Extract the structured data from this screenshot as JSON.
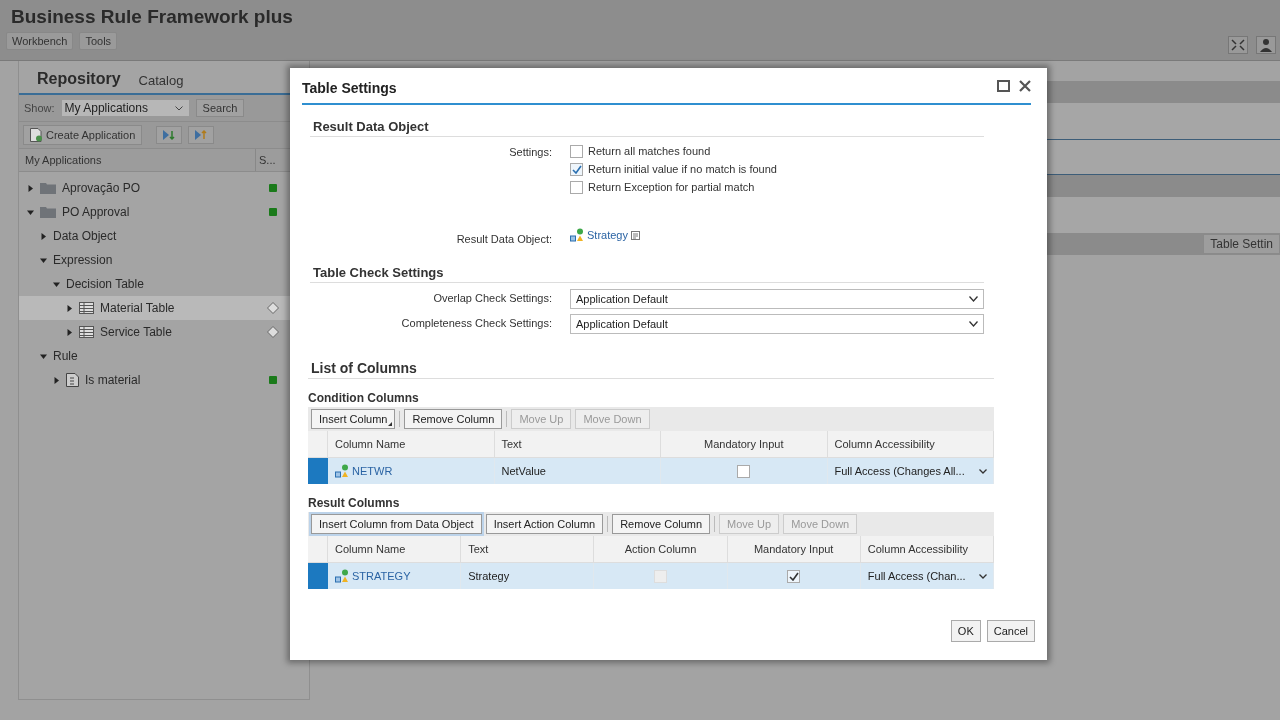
{
  "app": {
    "title": "Business Rule Framework plus",
    "menus": [
      {
        "label": "Workbench"
      },
      {
        "label": "Tools"
      }
    ],
    "tabs": [
      {
        "label": "Repository",
        "selected": true
      },
      {
        "label": "Catalog",
        "selected": false
      }
    ],
    "show": {
      "label": "Show:",
      "value": "My Applications"
    },
    "search_button": "Search",
    "create_button": "Create Application",
    "tree_columns": [
      "My Applications",
      "S..."
    ],
    "tree": [
      {
        "label": "Aprovação PO",
        "kind": "folder",
        "expanded": false,
        "selected": false,
        "active": true
      },
      {
        "label": "PO Approval",
        "kind": "folder",
        "expanded": true,
        "selected": false,
        "active": true,
        "children": [
          {
            "label": "Data Object",
            "expanded": false,
            "selected": false
          },
          {
            "label": "Expression",
            "expanded": true,
            "selected": false,
            "children": [
              {
                "label": "Decision Table",
                "expanded": true,
                "selected": false,
                "children": [
                  {
                    "label": "Material Table",
                    "kind": "table",
                    "expanded": false,
                    "selected": true,
                    "active": false
                  },
                  {
                    "label": "Service Table",
                    "kind": "table",
                    "expanded": false,
                    "selected": false,
                    "active": false
                  }
                ]
              }
            ]
          },
          {
            "label": "Rule",
            "expanded": true,
            "selected": false,
            "children": [
              {
                "label": "Is material",
                "kind": "rule",
                "expanded": false,
                "selected": false,
                "active": true
              }
            ]
          }
        ]
      }
    ],
    "right_button": "Table Settin"
  },
  "dialog": {
    "title": "Table Settings",
    "result_section": {
      "title": "Result Data Object",
      "settings_label": "Settings:",
      "options": [
        {
          "label": "Return all matches found",
          "checked": false
        },
        {
          "label": "Return initial value if no match is found",
          "checked": true
        },
        {
          "label": "Return Exception for partial match",
          "checked": false
        }
      ],
      "object_label": "Result Data Object:",
      "object_value": "Strategy"
    },
    "check_section": {
      "title": "Table Check Settings",
      "fields": [
        {
          "label": "Overlap Check Settings:",
          "value": "Application Default"
        },
        {
          "label": "Completeness Check Settings:",
          "value": "Application Default"
        }
      ]
    },
    "columns_section": {
      "title": "List of Columns",
      "tables": [
        {
          "title": "Condition Columns",
          "toolbar": [
            {
              "label": "Insert Column",
              "disabled": false,
              "menu": true,
              "focused": false
            },
            {
              "label": "Remove Column",
              "disabled": false,
              "menu": false,
              "focused": false
            },
            {
              "label": "Move Up",
              "disabled": true,
              "menu": false,
              "focused": false
            },
            {
              "label": "Move Down",
              "disabled": true,
              "menu": false,
              "focused": false
            }
          ],
          "columns": [
            {
              "label": "Column Name",
              "centered": false
            },
            {
              "label": "Text",
              "centered": false
            },
            {
              "label": "Mandatory Input",
              "centered": true
            },
            {
              "label": "Column Accessibility",
              "centered": false
            }
          ],
          "rows": [
            {
              "selected": true,
              "cells": [
                {
                  "kind": "object",
                  "text": "NETWR"
                },
                {
                  "kind": "text",
                  "text": "NetValue"
                },
                {
                  "kind": "check",
                  "checked": false,
                  "disabled": false
                },
                {
                  "kind": "select",
                  "text": "Full Access (Changes All..."
                }
              ]
            }
          ]
        },
        {
          "title": "Result Columns",
          "toolbar": [
            {
              "label": "Insert Column from Data Object",
              "disabled": false,
              "menu": false,
              "focused": true
            },
            {
              "label": "Insert Action Column",
              "disabled": false,
              "menu": false,
              "focused": false
            },
            {
              "label": "Remove Column",
              "disabled": false,
              "menu": false,
              "focused": false
            },
            {
              "label": "Move Up",
              "disabled": true,
              "menu": false,
              "focused": false
            },
            {
              "label": "Move Down",
              "disabled": true,
              "menu": false,
              "focused": false
            }
          ],
          "columns": [
            {
              "label": "Column Name",
              "centered": false
            },
            {
              "label": "Text",
              "centered": false
            },
            {
              "label": "Action Column",
              "centered": true
            },
            {
              "label": "Mandatory Input",
              "centered": true
            },
            {
              "label": "Column Accessibility",
              "centered": false
            }
          ],
          "rows": [
            {
              "selected": true,
              "cells": [
                {
                  "kind": "object",
                  "text": "STRATEGY"
                },
                {
                  "kind": "text",
                  "text": "Strategy"
                },
                {
                  "kind": "check",
                  "checked": false,
                  "disabled": true
                },
                {
                  "kind": "check",
                  "checked": true,
                  "disabled": false
                },
                {
                  "kind": "select",
                  "text": "Full Access (Chan..."
                }
              ]
            }
          ]
        }
      ]
    },
    "buttons": [
      {
        "label": "OK"
      },
      {
        "label": "Cancel"
      }
    ]
  }
}
